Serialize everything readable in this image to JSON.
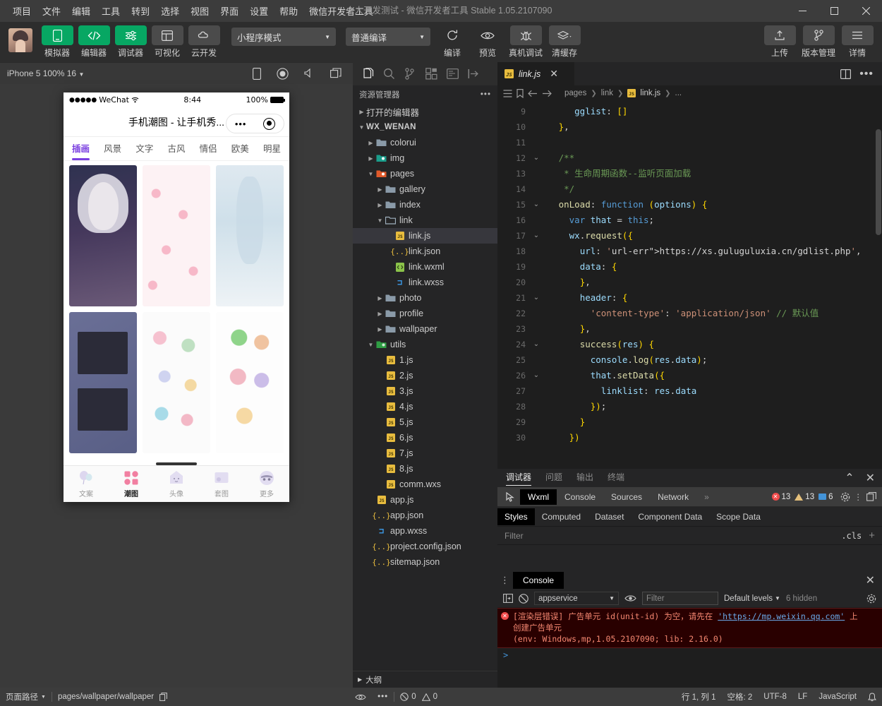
{
  "titlebar": {
    "menus": [
      "项目",
      "文件",
      "编辑",
      "工具",
      "转到",
      "选择",
      "视图",
      "界面",
      "设置",
      "帮助",
      "微信开发者工具"
    ],
    "title": "个人开发测试 - 微信开发者工具 Stable 1.05.2107090",
    "minimize": "minimize-icon",
    "maximize": "maximize-icon",
    "close": "close-icon"
  },
  "toolbar": {
    "buttons": [
      {
        "label": "模拟器",
        "icon": "phone-icon",
        "style": "green"
      },
      {
        "label": "编辑器",
        "icon": "code-icon",
        "style": "green"
      },
      {
        "label": "调试器",
        "icon": "sliders-icon",
        "style": "green"
      },
      {
        "label": "可视化",
        "icon": "layout-icon",
        "style": "grey"
      },
      {
        "label": "云开发",
        "icon": "cloud-icon",
        "style": "grey"
      }
    ],
    "mode_select": "小程序模式",
    "compile_select": "普通编译",
    "actions": [
      {
        "label": "编译",
        "icon": "refresh-icon"
      },
      {
        "label": "预览",
        "icon": "eye-icon"
      },
      {
        "label": "真机调试",
        "icon": "bug-icon"
      },
      {
        "label": "清缓存",
        "icon": "layers-icon"
      }
    ],
    "right_actions": [
      {
        "label": "上传",
        "icon": "upload-icon"
      },
      {
        "label": "版本管理",
        "icon": "branch-icon"
      },
      {
        "label": "详情",
        "icon": "menu-icon"
      }
    ]
  },
  "simulator": {
    "device": "iPhone 5 100% 16",
    "icons": [
      "phone-icon",
      "record-icon",
      "volume-icon",
      "windows-icon"
    ],
    "phone": {
      "carrier": "WeChat",
      "signal_dots": "●●●●●",
      "wifi": "wifi-icon",
      "time": "8:44",
      "battery_pct": "100%",
      "nav_title": "手机潮图 - 让手机秀...",
      "capsule_dots": "•••",
      "categories": [
        "插画",
        "风景",
        "文字",
        "古风",
        "情侣",
        "欧美",
        "明星"
      ],
      "active_category": "插画",
      "tabbar": [
        {
          "label": "文案",
          "icon": "balloon-icon",
          "active": false
        },
        {
          "label": "潮图",
          "icon": "grid-icon",
          "active": true
        },
        {
          "label": "头像",
          "icon": "avatar-icon",
          "active": false
        },
        {
          "label": "套图",
          "icon": "album-icon",
          "active": false
        },
        {
          "label": "更多",
          "icon": "more-icon",
          "active": false
        }
      ]
    }
  },
  "explorer": {
    "activity_icons": [
      "files-icon",
      "search-icon",
      "source-control-icon",
      "extensions-icon",
      "wxml-icon",
      "collapse-icon"
    ],
    "header": "资源管理器",
    "header_more": "more-icon",
    "tree": [
      {
        "label": "打开的编辑器",
        "depth": 0,
        "twisty": "right",
        "icon": "none",
        "kind": "section"
      },
      {
        "label": "WX_WENAN",
        "depth": 0,
        "twisty": "down",
        "icon": "none",
        "kind": "root"
      },
      {
        "label": "colorui",
        "depth": 1,
        "twisty": "right",
        "icon": "folder",
        "kind": "folder"
      },
      {
        "label": "img",
        "depth": 1,
        "twisty": "right",
        "icon": "folder-img",
        "kind": "folder"
      },
      {
        "label": "pages",
        "depth": 1,
        "twisty": "down",
        "icon": "folder-pages",
        "kind": "folder"
      },
      {
        "label": "gallery",
        "depth": 2,
        "twisty": "right",
        "icon": "folder",
        "kind": "folder"
      },
      {
        "label": "index",
        "depth": 2,
        "twisty": "right",
        "icon": "folder",
        "kind": "folder"
      },
      {
        "label": "link",
        "depth": 2,
        "twisty": "down",
        "icon": "folder-open",
        "kind": "folder"
      },
      {
        "label": "link.js",
        "depth": 3,
        "twisty": "none",
        "icon": "js",
        "kind": "file",
        "selected": true
      },
      {
        "label": "link.json",
        "depth": 3,
        "twisty": "none",
        "icon": "json",
        "kind": "file"
      },
      {
        "label": "link.wxml",
        "depth": 3,
        "twisty": "none",
        "icon": "wxml",
        "kind": "file"
      },
      {
        "label": "link.wxss",
        "depth": 3,
        "twisty": "none",
        "icon": "wxss",
        "kind": "file"
      },
      {
        "label": "photo",
        "depth": 2,
        "twisty": "right",
        "icon": "folder",
        "kind": "folder"
      },
      {
        "label": "profile",
        "depth": 2,
        "twisty": "right",
        "icon": "folder",
        "kind": "folder"
      },
      {
        "label": "wallpaper",
        "depth": 2,
        "twisty": "right",
        "icon": "folder",
        "kind": "folder"
      },
      {
        "label": "utils",
        "depth": 1,
        "twisty": "down",
        "icon": "folder-utils",
        "kind": "folder"
      },
      {
        "label": "1.js",
        "depth": 2,
        "twisty": "none",
        "icon": "js",
        "kind": "file"
      },
      {
        "label": "2.js",
        "depth": 2,
        "twisty": "none",
        "icon": "js",
        "kind": "file"
      },
      {
        "label": "3.js",
        "depth": 2,
        "twisty": "none",
        "icon": "js",
        "kind": "file"
      },
      {
        "label": "4.js",
        "depth": 2,
        "twisty": "none",
        "icon": "js",
        "kind": "file"
      },
      {
        "label": "5.js",
        "depth": 2,
        "twisty": "none",
        "icon": "js",
        "kind": "file"
      },
      {
        "label": "6.js",
        "depth": 2,
        "twisty": "none",
        "icon": "js",
        "kind": "file"
      },
      {
        "label": "7.js",
        "depth": 2,
        "twisty": "none",
        "icon": "js",
        "kind": "file"
      },
      {
        "label": "8.js",
        "depth": 2,
        "twisty": "none",
        "icon": "js",
        "kind": "file"
      },
      {
        "label": "comm.wxs",
        "depth": 2,
        "twisty": "none",
        "icon": "js",
        "kind": "file"
      },
      {
        "label": "app.js",
        "depth": 1,
        "twisty": "none",
        "icon": "js",
        "kind": "file"
      },
      {
        "label": "app.json",
        "depth": 1,
        "twisty": "none",
        "icon": "json",
        "kind": "file"
      },
      {
        "label": "app.wxss",
        "depth": 1,
        "twisty": "none",
        "icon": "wxss",
        "kind": "file"
      },
      {
        "label": "project.config.json",
        "depth": 1,
        "twisty": "none",
        "icon": "json",
        "kind": "file"
      },
      {
        "label": "sitemap.json",
        "depth": 1,
        "twisty": "none",
        "icon": "json",
        "kind": "file"
      }
    ],
    "outline": "大纲"
  },
  "editor": {
    "tab": {
      "label": "link.js",
      "icon": "js-icon",
      "close": "close-icon"
    },
    "tab_actions": [
      "split-editor-icon",
      "more-actions-icon"
    ],
    "breadcrumb": {
      "icons": [
        "outline-icon",
        "bookmark-icon",
        "back-icon",
        "forward-icon"
      ],
      "path": [
        "pages",
        "link",
        "link.js",
        "..."
      ]
    },
    "lines": [
      {
        "no": "9",
        "fold": "",
        "text": "      gglist: []"
      },
      {
        "no": "10",
        "fold": "",
        "text": "   },"
      },
      {
        "no": "11",
        "fold": "",
        "text": ""
      },
      {
        "no": "12",
        "fold": "down",
        "text": "   /**"
      },
      {
        "no": "13",
        "fold": "",
        "text": "    * 生命周期函数--监听页面加载"
      },
      {
        "no": "14",
        "fold": "",
        "text": "    */"
      },
      {
        "no": "15",
        "fold": "down",
        "text": "   onLoad: function (options) {"
      },
      {
        "no": "16",
        "fold": "",
        "text": "     var that = this;"
      },
      {
        "no": "17",
        "fold": "down",
        "text": "     wx.request({"
      },
      {
        "no": "18",
        "fold": "",
        "text": "       url: 'https://xs.guluguluxia.cn/gdlist.php',"
      },
      {
        "no": "19",
        "fold": "",
        "text": "       data: {"
      },
      {
        "no": "20",
        "fold": "",
        "text": "       },"
      },
      {
        "no": "21",
        "fold": "down",
        "text": "       header: {"
      },
      {
        "no": "22",
        "fold": "",
        "text": "         'content-type': 'application/json' // 默认值"
      },
      {
        "no": "23",
        "fold": "",
        "text": "       },"
      },
      {
        "no": "24",
        "fold": "down",
        "text": "       success(res) {"
      },
      {
        "no": "25",
        "fold": "",
        "text": "         console.log(res.data);"
      },
      {
        "no": "26",
        "fold": "down",
        "text": "         that.setData({"
      },
      {
        "no": "27",
        "fold": "",
        "text": "           linklist: res.data"
      },
      {
        "no": "28",
        "fold": "",
        "text": "         });"
      },
      {
        "no": "29",
        "fold": "",
        "text": "       }"
      },
      {
        "no": "30",
        "fold": "",
        "text": "     })"
      }
    ]
  },
  "debugger": {
    "panel_tabs": [
      "调试器",
      "问题",
      "输出",
      "终端"
    ],
    "panel_active": "调试器",
    "panel_actions": [
      "chevron-up-icon",
      "close-icon"
    ],
    "devtool_tabs": [
      "Wxml",
      "Console",
      "Sources",
      "Network"
    ],
    "devtool_active": "Wxml",
    "devtool_overflow": "»",
    "inspect_icon": "inspect-icon",
    "counts": {
      "errors": "13",
      "warnings": "13",
      "info": "6"
    },
    "devtool_right_icons": [
      "gear-icon",
      "kebab-icon",
      "dock-icon"
    ],
    "style_tabs": [
      "Styles",
      "Computed",
      "Dataset",
      "Component Data",
      "Scope Data"
    ],
    "style_active": "Styles",
    "filter_placeholder": "Filter",
    "cls_label": ".cls",
    "plus_label": "+"
  },
  "console": {
    "kebab": "kebab-icon",
    "tab": "Console",
    "close": "close-icon",
    "toolbar_icons": [
      "sidebar-icon",
      "clear-icon",
      "eye-icon",
      "gear-icon"
    ],
    "context": "appservice",
    "filter_placeholder": "Filter",
    "levels": "Default levels",
    "hidden": "6 hidden",
    "error": {
      "line1_a": "[渲染层错误] 广告单元 id(unit-id) 为空，请先在 ",
      "link": "'https://mp.weixin.qq.com'",
      "line1_b": " 上",
      "line2": "创建广告单元",
      "line3": "(env: Windows,mp,1.05.2107090; lib: 2.16.0)"
    },
    "prompt": ">"
  },
  "statusbar": {
    "page_path_label": "页面路径",
    "page_path": "pages/wallpaper/wallpaper",
    "copy_icon": "copy-icon",
    "eye_icon": "eye-icon",
    "more_icon": "more-icon",
    "errors": "0",
    "warnings": "0",
    "position": "行 1, 列 1",
    "spaces": "空格: 2",
    "encoding": "UTF-8",
    "eol": "LF",
    "language": "JavaScript",
    "bell": "bell-icon"
  }
}
